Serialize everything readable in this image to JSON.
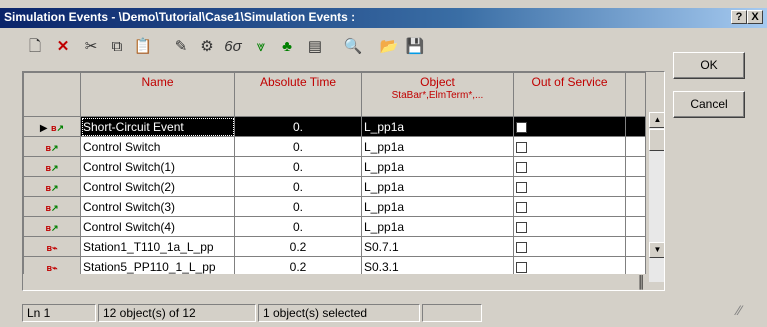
{
  "window": {
    "title": "Simulation Events - \\Demo\\Tutorial\\Case1\\Simulation Events :",
    "help_label": "?",
    "close_label": "X"
  },
  "toolbar": {
    "icons": [
      "new-object-icon",
      "delete-icon",
      "cut-icon",
      "copy-icon",
      "paste-icon",
      "edit-icon",
      "compare-icon",
      "script-icon",
      "filter-icon",
      "tree-icon",
      "detail-icon",
      "find-icon",
      "open-folder-icon",
      "save-icon"
    ]
  },
  "buttons": {
    "ok": "OK",
    "cancel": "Cancel"
  },
  "table": {
    "columns": {
      "name": "Name",
      "time": "Absolute Time",
      "object": "Object",
      "object_sub": "StaBar*,ElmTerm*,...",
      "oos": "Out of Service"
    },
    "rows": [
      {
        "name": "Short-Circuit Event",
        "time": "0.",
        "object": "L_pp1a"
      },
      {
        "name": "Control Switch",
        "time": "0.",
        "object": "L_pp1a"
      },
      {
        "name": "Control Switch(1)",
        "time": "0.",
        "object": "L_pp1a"
      },
      {
        "name": "Control Switch(2)",
        "time": "0.",
        "object": "L_pp1a"
      },
      {
        "name": "Control Switch(3)",
        "time": "0.",
        "object": "L_pp1a"
      },
      {
        "name": "Control Switch(4)",
        "time": "0.",
        "object": "L_pp1a"
      },
      {
        "name": "Station1_T110_1a_L_pp",
        "time": "0.2",
        "object": "S0.7.1"
      },
      {
        "name": "Station5_PP110_1_L_pp",
        "time": "0.2",
        "object": "S0.3.1"
      }
    ]
  },
  "status": {
    "line": "Ln 1",
    "count": "12 object(s) of 12",
    "selected": "1 object(s) selected",
    "extra": ""
  }
}
